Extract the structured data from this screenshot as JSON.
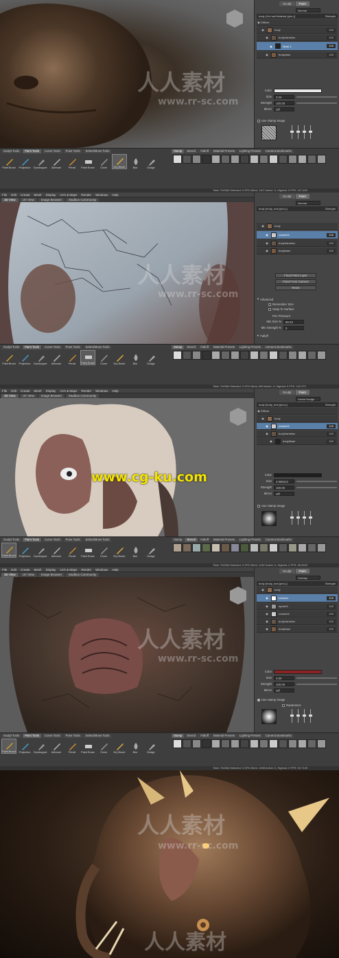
{
  "menu": [
    "File",
    "Edit",
    "Create",
    "Mesh",
    "Display",
    "UVs & Maps",
    "Render",
    "Windows",
    "Help"
  ],
  "view_tabs": [
    "3D View",
    "UV View",
    "Image Browser",
    "Mudbox Community"
  ],
  "panel_tabs": [
    "Sculpt",
    "Paint"
  ],
  "tool_tabs": [
    "Sculpt Tools",
    "Paint Tools",
    "Curve Tools",
    "Pose Tools",
    "Select/Move Tools"
  ],
  "tools": [
    "Paint Brush",
    "Projection",
    "Eyedropper",
    "Airbrush",
    "Pencil",
    "Paint Erase",
    "Clone",
    "Dry Brush",
    "Blur",
    "Dodge"
  ],
  "stamp_tabs": [
    "Stamp",
    "Stencil",
    "Falloff",
    "Material Presets",
    "Lighting Presets",
    "Camera Bookmarks"
  ],
  "panels": [
    {
      "blend": "Normal",
      "layer_header": {
        "name": "body (2x4 salt Material (pbo-))",
        "strength": "Strength"
      },
      "layers": [
        {
          "name": "Diffuse",
          "value": ""
        },
        {
          "name": "body",
          "value": "100"
        },
        {
          "name": "bodyVariation",
          "value": "100"
        },
        {
          "name": "Mask 1",
          "value": "100"
        },
        {
          "name": "bodybase",
          "value": "100"
        }
      ],
      "props": [
        {
          "k": "Color",
          "v": ""
        },
        {
          "k": "Size",
          "v": "3.24"
        },
        {
          "k": "Strength",
          "v": "100.00"
        },
        {
          "k": "Mirror",
          "v": "Off"
        }
      ],
      "stamp_label": "Use Stamp Image",
      "status": "Total: 704384  Selected: 0  GPU Mem: 1107  Active: 0, Highest: 0  FPS: 127.439"
    },
    {
      "blend": "Normal",
      "layer_header": {
        "name": "body (body_mat (pbo-))",
        "strength": "Strength"
      },
      "layers": [
        {
          "name": "body",
          "value": "100"
        },
        {
          "name": "cracks01",
          "value": "100"
        },
        {
          "name": "bodyVariation",
          "value": "100"
        },
        {
          "name": "bodybase",
          "value": "100"
        }
      ],
      "buttons": [
        "Flood Paint Layer",
        "Paint From Camera",
        "Reset"
      ],
      "advanced": "Advanced",
      "checks": [
        "Remember Size",
        "Snap To Surface"
      ],
      "pen_pressure": "Pen Pressure:",
      "min_size": {
        "k": "Min Size %",
        "v": "69.23"
      },
      "min_strength": {
        "k": "Min Strength %",
        "v": "0"
      },
      "falloff": "Falloff",
      "status": "Total: 704384  Selected: 0  GPU Mem: 883  Active: 0, Highest: 0  FPS: 122.372"
    },
    {
      "blend": "Linear Dodge (Add)",
      "layer_header": {
        "name": "body (body_mat (pbo-))",
        "strength": "Strength"
      },
      "layers": [
        {
          "name": "Diffuse",
          "value": ""
        },
        {
          "name": "body",
          "value": "100"
        },
        {
          "name": "cracks01",
          "value": "100"
        },
        {
          "name": "bodyVariation",
          "value": "100"
        },
        {
          "name": "bodyMask",
          "value": "100"
        }
      ],
      "props": [
        {
          "k": "Color",
          "v": ""
        },
        {
          "k": "Size",
          "v": "4.066212"
        },
        {
          "k": "Strength",
          "v": "100.00"
        },
        {
          "k": "Mirror",
          "v": "Off"
        }
      ],
      "stamp_label": "Use Stamp Image",
      "status": "Total: 704384  Selected: 0  GPU Mem: 1087  Active: 0, Highest: 0  FPS: 38.3629"
    },
    {
      "blend": "Overlay",
      "layer_header": {
        "name": "body (body_mat (pbo-))",
        "strength": "Strength"
      },
      "layers": [
        {
          "name": "body",
          "value": "100"
        },
        {
          "name": "redness",
          "value": "100"
        },
        {
          "name": "spots01",
          "value": "100"
        },
        {
          "name": "cracks01",
          "value": "100"
        },
        {
          "name": "bodyVariation",
          "value": "100"
        },
        {
          "name": "bodybase",
          "value": "100"
        }
      ],
      "props": [
        {
          "k": "Color",
          "v": ""
        },
        {
          "k": "Size",
          "v": "4.00"
        },
        {
          "k": "Strength",
          "v": "100.00"
        },
        {
          "k": "Mirror",
          "v": "Off"
        }
      ],
      "stamp_label": "Use Stamp Image",
      "random_label": "Randomize",
      "status": "Total: 704384  Selected: 0  GPU Mem: 1065  Active: 0, Highest: 0  FPS: 92.7149"
    }
  ],
  "watermark": {
    "cn": "人人素材",
    "url": "www.rr-sc.com"
  },
  "caption": "www.cg-ku.com",
  "colors": {
    "selected_layer": "#5a7fa8",
    "red_swatch": "#8a2424",
    "caption": "#f4e400"
  }
}
